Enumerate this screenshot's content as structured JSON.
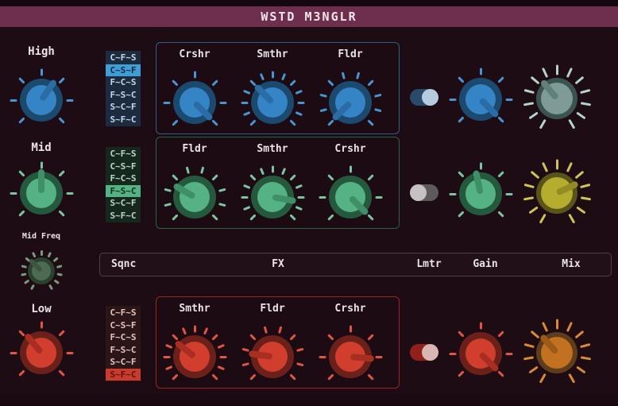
{
  "title": "WSTD M3NGLR",
  "header": {
    "columns": [
      "Sqnc",
      "FX",
      "Lmtr",
      "Gain",
      "Mix"
    ]
  },
  "seq_options": [
    "C~F~S",
    "C~S~F",
    "F~C~S",
    "F~S~C",
    "S~C~F",
    "S~F~C"
  ],
  "mid_freq": {
    "label": "Mid Freq",
    "knob": {
      "angle": -45,
      "ticks": 13
    },
    "colors": {
      "inner": "#4d6b52",
      "ring": "#2a4030",
      "pointer": "#3d5642",
      "tick": "#7a9a7e"
    }
  },
  "bands": [
    {
      "id": "high",
      "label": "High",
      "seq": {
        "selected": "C~S~F",
        "selected_index": 1
      },
      "limiter_on": true,
      "main_knob": {
        "angle": 35,
        "ticks": 7
      },
      "fx": [
        {
          "label": "Crshr",
          "angle": 135,
          "ticks": 7
        },
        {
          "label": "Smthr",
          "angle": -45,
          "ticks": 13
        },
        {
          "label": "Fldr",
          "angle": -135,
          "ticks": 10
        }
      ],
      "gain_knob": {
        "angle": 135,
        "ticks": 7
      },
      "mix_knob": {
        "angle": -40,
        "ticks": 13
      },
      "colors": {
        "knob_inner": "#3584c6",
        "knob_ring": "#1c4a6e",
        "knob_pointer": "#2a6da6",
        "tick": "#4a94d0",
        "panel_border": "#2e5f86",
        "list_bg": "#1c2b3f",
        "list_text": "#c6d8e8",
        "selected_bg": "#3f9ed8",
        "selected_text": "#12293d",
        "toggle_track": "#2a4a6c",
        "toggle_thumb": "#b4ccdd",
        "mix_inner": "#7e9b97",
        "mix_ring": "#3b5350",
        "mix_pointer": "#61807c",
        "mix_tick": "#b5d2cb"
      }
    },
    {
      "id": "mid",
      "label": "Mid",
      "seq": {
        "selected": "F~S~C",
        "selected_index": 3
      },
      "limiter_on": false,
      "main_knob": {
        "angle": 0,
        "ticks": 7
      },
      "fx": [
        {
          "label": "Fldr",
          "angle": -60,
          "ticks": 10
        },
        {
          "label": "Smthr",
          "angle": 100,
          "ticks": 13
        },
        {
          "label": "Crshr",
          "angle": 135,
          "ticks": 7
        }
      ],
      "gain_knob": {
        "angle": -12,
        "ticks": 7
      },
      "mix_knob": {
        "angle": 65,
        "ticks": 13
      },
      "colors": {
        "knob_inner": "#55b285",
        "knob_ring": "#25593e",
        "knob_pointer": "#3f8f68",
        "tick": "#7cc4a2",
        "panel_border": "#2c5f44",
        "list_bg": "#16281e",
        "list_text": "#bcd8c6",
        "selected_bg": "#55b285",
        "selected_text": "#0f2e1d",
        "toggle_track": "#5e5a5c",
        "toggle_thumb": "#c6c2c4",
        "mix_inner": "#b5ad2e",
        "mix_ring": "#59531c",
        "mix_pointer": "#938c24",
        "mix_tick": "#cfc455"
      }
    },
    {
      "id": "low",
      "label": "Low",
      "seq": {
        "selected": "S~F~C",
        "selected_index": 5
      },
      "limiter_on": true,
      "main_knob": {
        "angle": -40,
        "ticks": 7
      },
      "fx": [
        {
          "label": "Smthr",
          "angle": -52,
          "ticks": 13
        },
        {
          "label": "Fldr",
          "angle": -82,
          "ticks": 10
        },
        {
          "label": "Crshr",
          "angle": 95,
          "ticks": 7
        }
      ],
      "gain_knob": {
        "angle": 135,
        "ticks": 7
      },
      "mix_knob": {
        "angle": -42,
        "ticks": 13
      },
      "colors": {
        "knob_inner": "#d23e2e",
        "knob_ring": "#6b2019",
        "knob_pointer": "#a92e22",
        "tick": "#e05544",
        "panel_border": "#93281f",
        "list_bg": "#2c1517",
        "list_text": "#e6c4c0",
        "selected_bg": "#c83b2d",
        "selected_text": "#58150f",
        "toggle_track": "#8f211a",
        "toggle_thumb": "#d9b6b1",
        "mix_inner": "#c17120",
        "mix_ring": "#5e3d1c",
        "mix_pointer": "#9c5a18",
        "mix_tick": "#d98a32"
      }
    }
  ],
  "global_colors": {
    "background": "#1e0c15",
    "titlebar": "#6e2e4e",
    "title_text": "#efe7eb",
    "label_text": "#ebe3e7",
    "header_border": "#4e3e48",
    "toggle_off_track": "#5e5a5c",
    "toggle_off_thumb": "#c6c2c4"
  }
}
